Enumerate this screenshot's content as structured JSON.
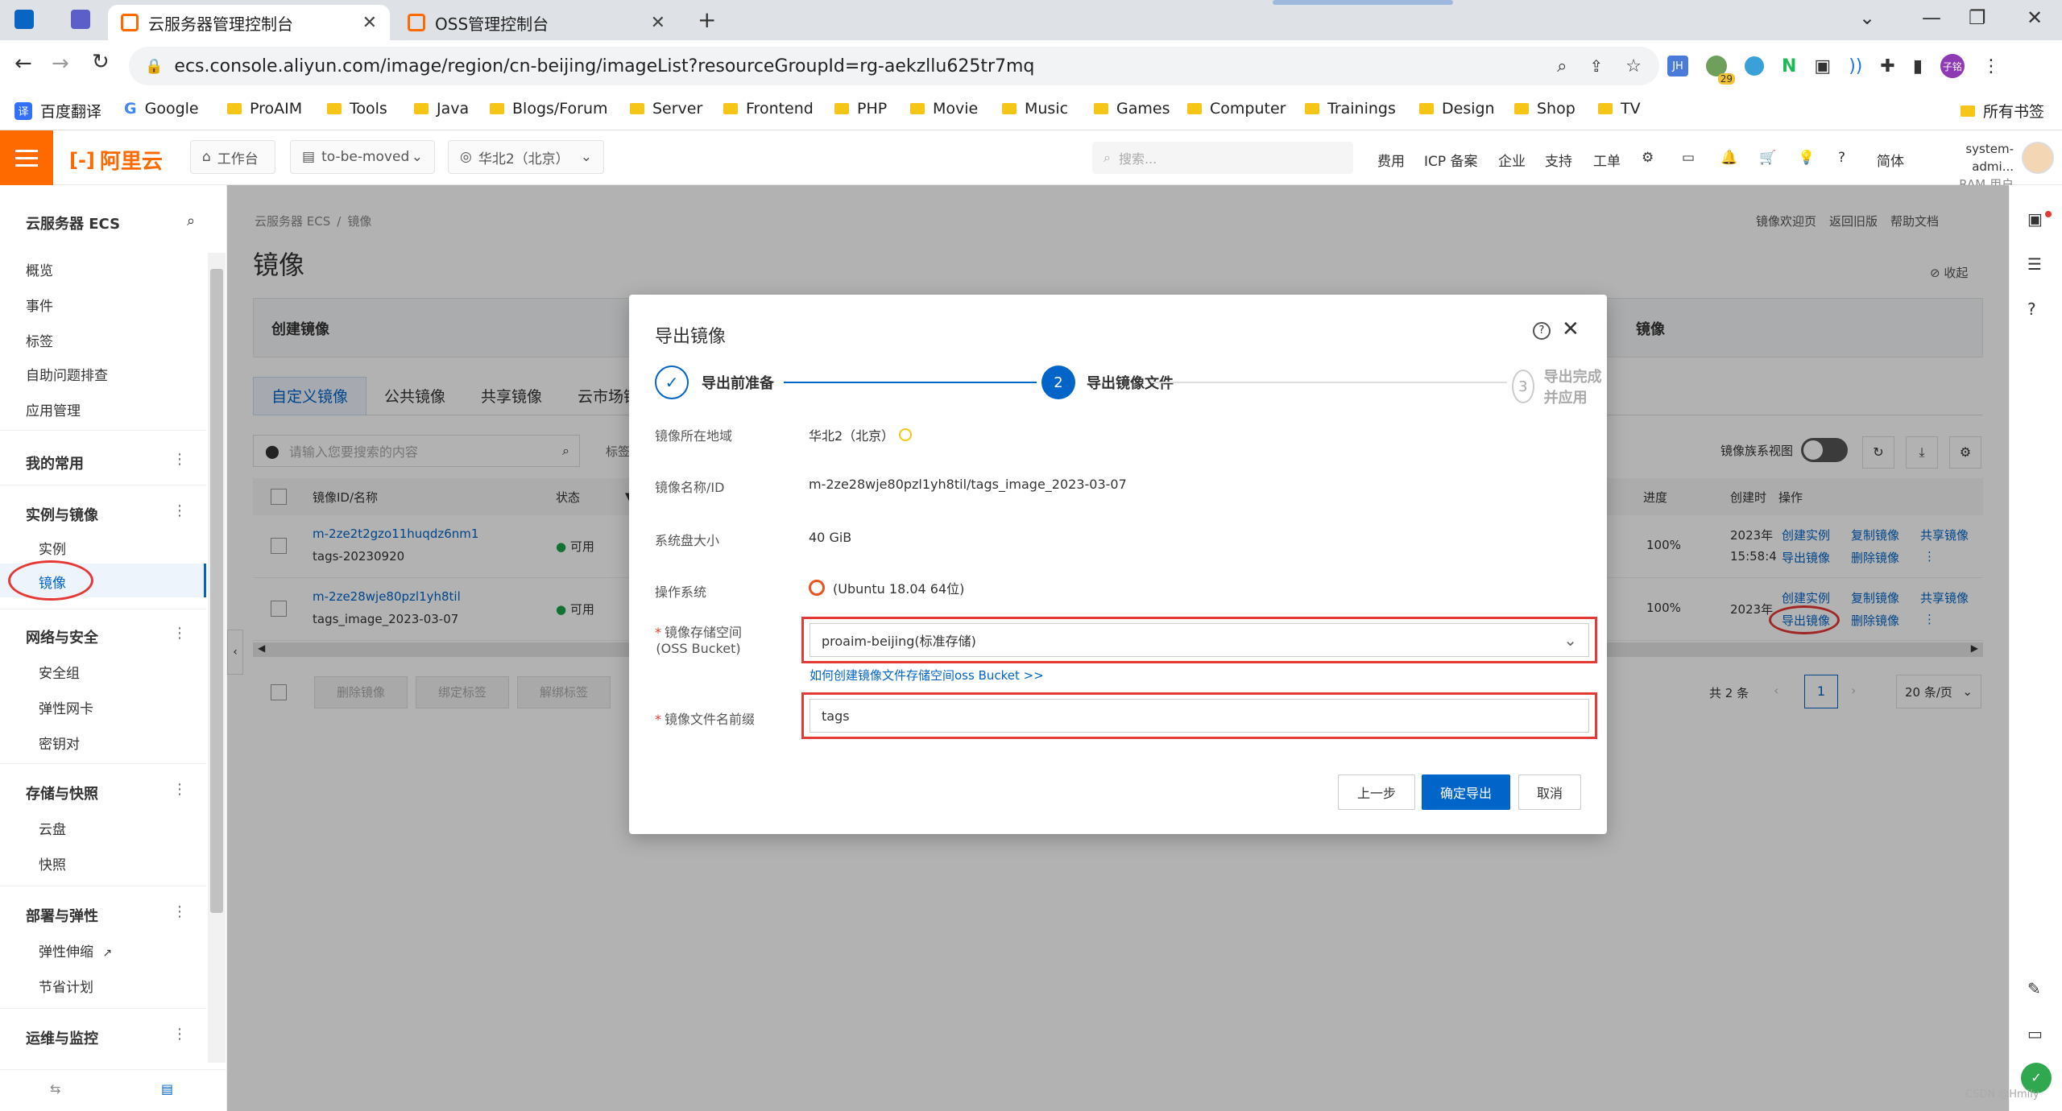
{
  "browser": {
    "tabs": [
      {
        "title": "云服务器管理控制台",
        "active": true
      },
      {
        "title": "OSS管理控制台",
        "active": false
      }
    ],
    "url": "ecs.console.aliyun.com/image/region/cn-beijing/imageList?resourceGroupId=rg-aekzllu625tr7mq",
    "ext_badge": "29",
    "profile": "子铭",
    "bookmarks": [
      "百度翻译",
      "Google",
      "ProAIM",
      "Tools",
      "Java",
      "Blogs/Forum",
      "Server",
      "Frontend",
      "PHP",
      "Movie",
      "Music",
      "Games",
      "Computer",
      "Trainings",
      "Design",
      "Shop",
      "TV"
    ],
    "all_bookmarks": "所有书签"
  },
  "console": {
    "logo": "阿里云",
    "workbench": "工作台",
    "resource_group": "to-be-moved",
    "region": "华北2（北京）",
    "search_placeholder": "搜索...",
    "nav": [
      "费用",
      "ICP 备案",
      "企业",
      "支持",
      "工单"
    ],
    "lang": "简体",
    "user_name": "system-admi...",
    "user_role": "RAM 用户"
  },
  "sidebar": {
    "title": "云服务器 ECS",
    "top_items": [
      "概览",
      "事件",
      "标签",
      "自助问题排查",
      "应用管理"
    ],
    "fav": "我的常用",
    "group1": "实例与镜像",
    "g1_items": [
      "实例",
      "镜像"
    ],
    "group2": "网络与安全",
    "g2_items": [
      "安全组",
      "弹性网卡",
      "密钥对"
    ],
    "group3": "存储与快照",
    "g3_items": [
      "云盘",
      "快照"
    ],
    "group4": "部署与弹性",
    "g4_items": [
      "弹性伸缩",
      "节省计划"
    ],
    "group5": "运维与监控"
  },
  "page": {
    "breadcrumb_root": "云服务器 ECS",
    "breadcrumb_sep": "/",
    "breadcrumb_cur": "镜像",
    "title": "镜像",
    "top_links": [
      "镜像欢迎页",
      "返回旧版",
      "帮助文档"
    ],
    "collapse": "收起",
    "banner_left": "创建镜像",
    "banner_right": "镜像",
    "tabs": [
      "自定义镜像",
      "公共镜像",
      "共享镜像",
      "云市场镜"
    ],
    "search_placeholder": "请输入您要搜索的内容",
    "tag_btn": "标签",
    "family_view": "镜像族系视图",
    "columns": {
      "id": "镜像ID/名称",
      "status": "状态",
      "progress": "进度",
      "created": "创建时",
      "ops": "操作"
    },
    "rows": [
      {
        "id": "m-2ze2t2gzo11huqdz6nm1",
        "name": "tags-20230920",
        "status": "可用",
        "progress": "100%",
        "created": "2023年",
        "created2": "15:58:4",
        "ops1": [
          "创建实例",
          "复制镜像",
          "共享镜像"
        ],
        "ops2": [
          "导出镜像",
          "删除镜像"
        ]
      },
      {
        "id": "m-2ze28wje80pzl1yh8til",
        "name": "tags_image_2023-03-07",
        "status": "可用",
        "progress": "100%",
        "created": "2023年",
        "created2": "",
        "ops1": [
          "创建实例",
          "复制镜像",
          "共享镜像"
        ],
        "ops2": [
          "导出镜像",
          "删除镜像"
        ]
      }
    ],
    "bulk": [
      "删除镜像",
      "绑定标签",
      "解绑标签"
    ],
    "total": "共 2 条",
    "page_num": "1",
    "page_size": "20 条/页"
  },
  "modal": {
    "title": "导出镜像",
    "steps": [
      {
        "num": "✓",
        "label": "导出前准备"
      },
      {
        "num": "2",
        "label": "导出镜像文件"
      },
      {
        "num": "3",
        "label": "导出完成并应用"
      }
    ],
    "region_label": "镜像所在地域",
    "region_value": "华北2（北京）",
    "name_label": "镜像名称/ID",
    "name_value": "m-2ze28wje80pzl1yh8til/tags_image_2023-03-07",
    "disk_label": "系统盘大小",
    "disk_value": "40 GiB",
    "os_label": "操作系统",
    "os_value": "(Ubuntu 18.04 64位)",
    "bucket_label1": "镜像存储空间",
    "bucket_label2": "(OSS Bucket)",
    "bucket_value": "proaim-beijing(标准存储)",
    "bucket_help": "如何创建镜像文件存储空间oss Bucket >>",
    "prefix_label": "镜像文件名前缀",
    "prefix_value": "tags",
    "btn_prev": "上一步",
    "btn_ok": "确定导出",
    "btn_cancel": "取消"
  },
  "watermark": "CSDN @Hmily",
  "colors": {
    "brand": "#ff6a00",
    "primary": "#0064c8",
    "highlight": "#e53935",
    "success": "#1aa34a"
  }
}
